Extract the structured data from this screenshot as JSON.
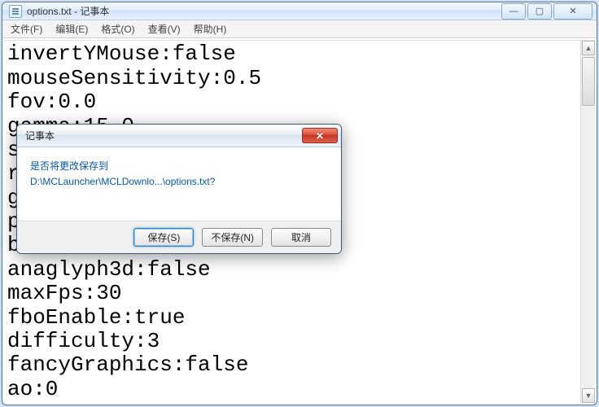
{
  "window": {
    "title": "options.txt - 记事本",
    "controls": {
      "min": "—",
      "max": "▢",
      "close": "✕"
    }
  },
  "menu": {
    "file": "文件(F)",
    "edit": "编辑(E)",
    "format": "格式(O)",
    "view": "查看(V)",
    "help": "帮助(H)"
  },
  "editor": {
    "content": "invertYMouse:false\nmouseSensitivity:0.5\nfov:0.0\ngamma:15.0\nsaturation:0.0\nrenderDistance:2\nguiScale:0\nparticles:0\nbobView:true\nanaglyph3d:false\nmaxFps:30\nfboEnable:true\ndifficulty:3\nfancyGraphics:false\nao:0"
  },
  "dialog": {
    "title": "记事本",
    "close_glyph": "✕",
    "message_line1": "是否将更改保存到",
    "message_line2": "D:\\MCLauncher\\MCLDownlo...\\options.txt?",
    "buttons": {
      "save": "保存(S)",
      "dont_save": "不保存(N)",
      "cancel": "取消"
    }
  },
  "scrollbar": {
    "up": "▲",
    "down": "▼"
  }
}
